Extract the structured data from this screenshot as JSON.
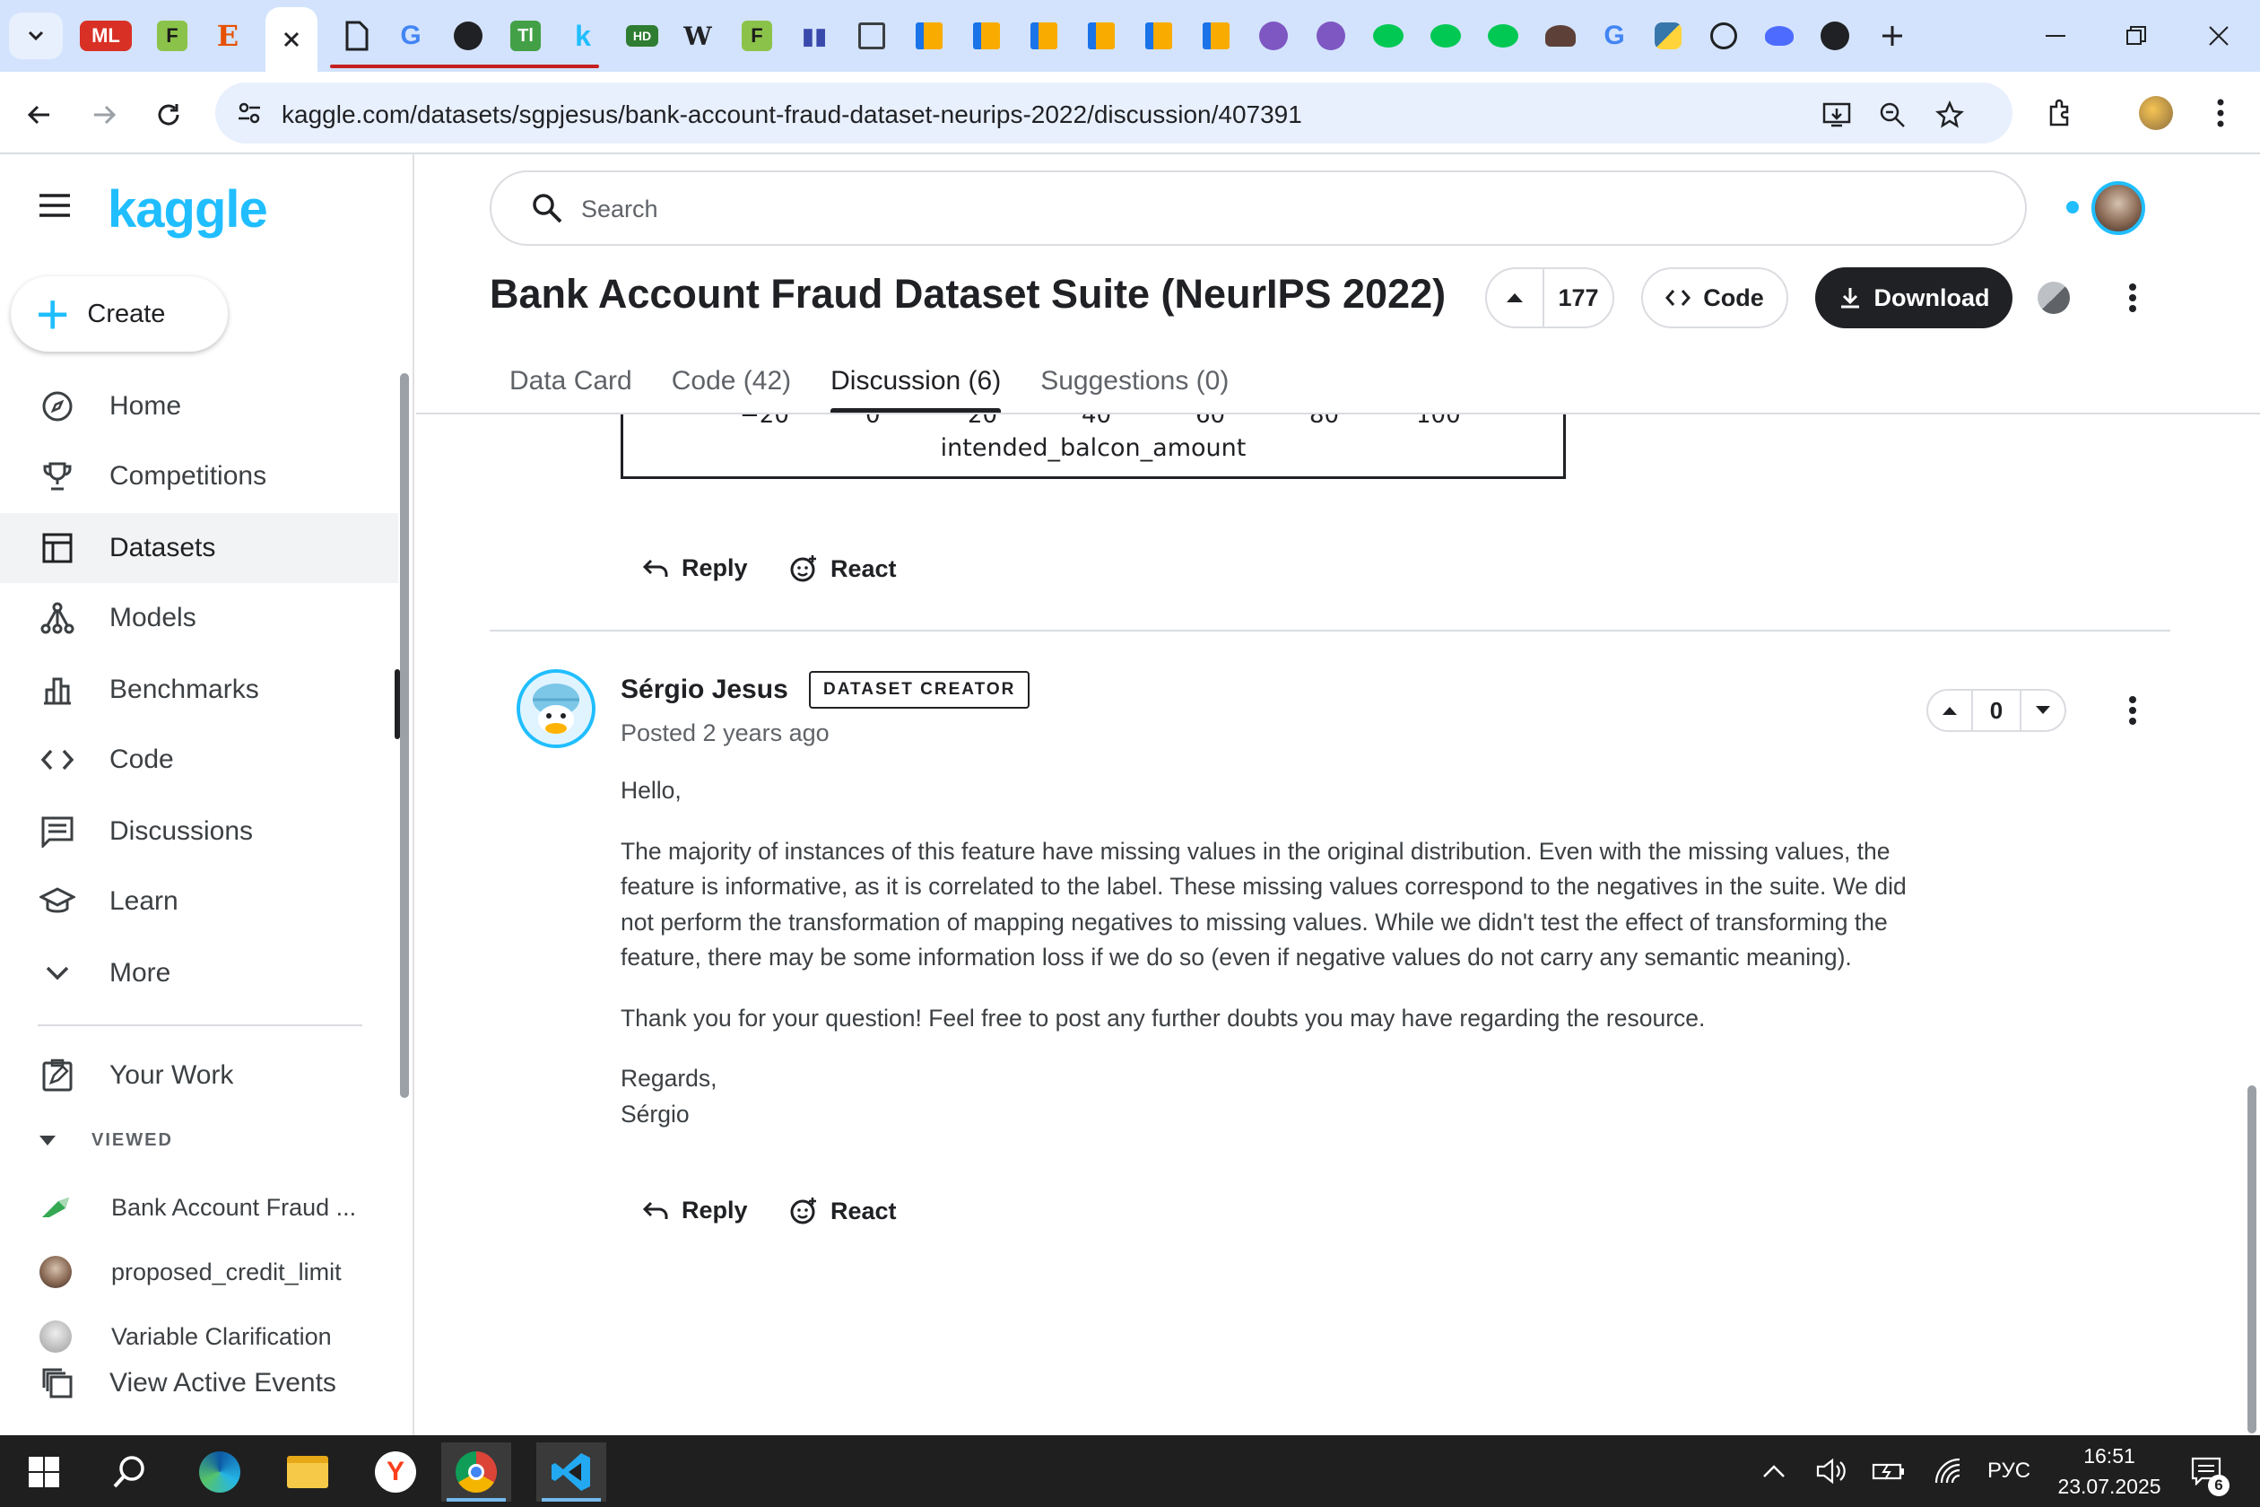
{
  "browser": {
    "tab_badge_ml": "ML",
    "tab_badge_e": "E",
    "url": "kaggle.com/datasets/sgpjesus/bank-account-fraud-dataset-neurips-2022/discussion/407391"
  },
  "sidebar": {
    "logo": "kaggle",
    "create_label": "Create",
    "items": [
      {
        "label": "Home",
        "icon": "compass-icon"
      },
      {
        "label": "Competitions",
        "icon": "trophy-icon"
      },
      {
        "label": "Datasets",
        "icon": "table-icon",
        "active": true
      },
      {
        "label": "Models",
        "icon": "models-icon"
      },
      {
        "label": "Benchmarks",
        "icon": "bar-chart-icon"
      },
      {
        "label": "Code",
        "icon": "code-icon"
      },
      {
        "label": "Discussions",
        "icon": "comment-icon"
      },
      {
        "label": "Learn",
        "icon": "graduation-cap-icon"
      },
      {
        "label": "More",
        "icon": "chevron-down-icon"
      }
    ],
    "your_work": "Your Work",
    "viewed_header": "VIEWED",
    "viewed": [
      {
        "label": "Bank Account Fraud ..."
      },
      {
        "label": "proposed_credit_limit"
      },
      {
        "label": "Variable Clarification"
      }
    ],
    "view_active_events": "View Active Events"
  },
  "header": {
    "search_placeholder": "Search"
  },
  "dataset": {
    "title": "Bank Account Fraud Dataset Suite (NeurIPS 2022)",
    "votes": "177",
    "code_label": "Code",
    "download_label": "Download",
    "tabs": [
      {
        "label": "Data Card"
      },
      {
        "label": "Code (42)"
      },
      {
        "label": "Discussion (6)",
        "active": true
      },
      {
        "label": "Suggestions (0)"
      }
    ]
  },
  "plot_fragment": {
    "ticks": [
      "−20",
      "0",
      "20",
      "40",
      "60",
      "80",
      "100"
    ],
    "xlabel": "intended_balcon_amount"
  },
  "actions": {
    "reply": "Reply",
    "react": "React"
  },
  "comment": {
    "author": "Sérgio Jesus",
    "badge": "DATASET CREATOR",
    "posted": "Posted 2 years ago",
    "votes": "0",
    "greeting": "Hello,",
    "paragraph1": "The majority of instances of this feature have missing values in the original distribution. Even with the missing values, the feature is informative, as it is correlated to the label. These missing values correspond to the negatives in the suite. We did not perform the transformation of mapping negatives to missing values. While we didn't test the effect of transforming the feature, there may be some information loss if we do so (even if negative values do not carry any semantic meaning).",
    "paragraph2": "Thank you for your question! Feel free to post any further doubts you may have regarding the resource.",
    "closing": "Regards,",
    "signature": "Sérgio"
  },
  "taskbar": {
    "lang": "РУС",
    "time": "16:51",
    "date": "23.07.2025",
    "notifications": "6"
  },
  "colors": {
    "kaggle_blue": "#20beff",
    "dark": "#202124",
    "tabstrip": "#d3e3fd"
  }
}
